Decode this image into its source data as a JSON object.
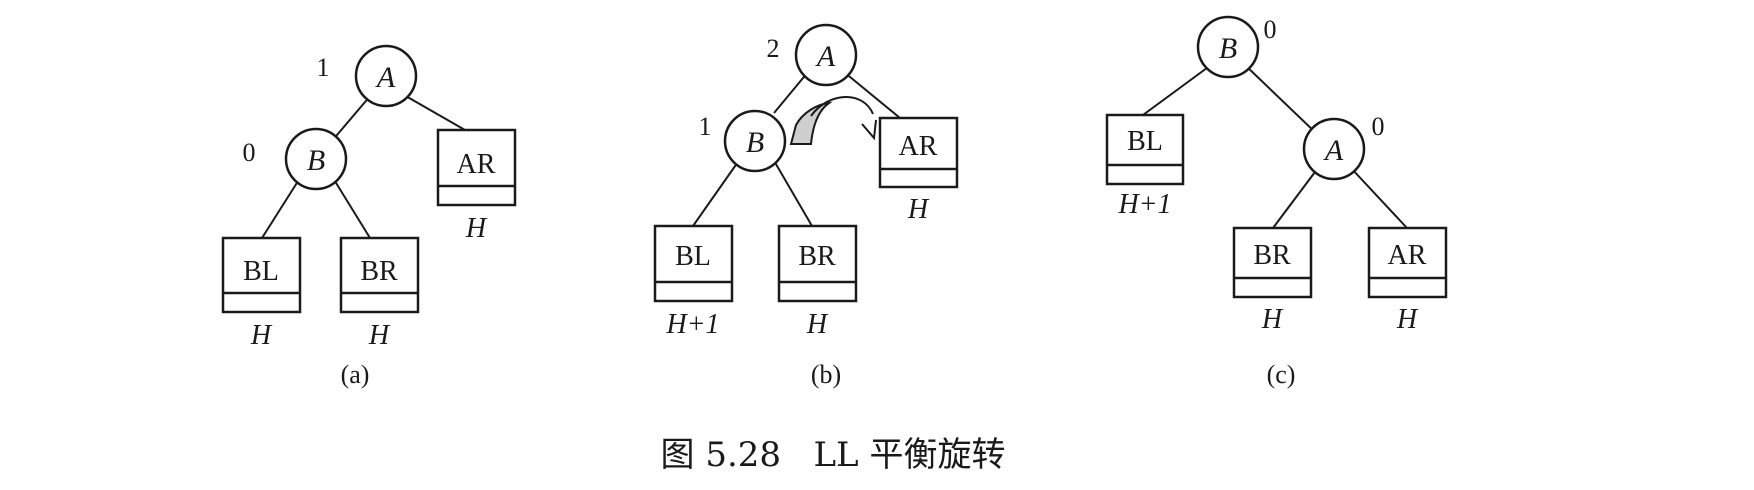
{
  "figure_caption": "图 5.28   LL 平衡旋转",
  "panels": [
    {
      "caption": "(a)",
      "nodes": [
        {
          "label": "A",
          "bf": "1"
        },
        {
          "label": "B",
          "bf": "0"
        }
      ],
      "subtrees": [
        {
          "label": "BL",
          "height": "H"
        },
        {
          "label": "BR",
          "height": "H"
        },
        {
          "label": "AR",
          "height": "H"
        }
      ]
    },
    {
      "caption": "(b)",
      "nodes": [
        {
          "label": "A",
          "bf": "2"
        },
        {
          "label": "B",
          "bf": "1"
        }
      ],
      "subtrees": [
        {
          "label": "BL",
          "height": "H+1"
        },
        {
          "label": "BR",
          "height": "H"
        },
        {
          "label": "AR",
          "height": "H"
        }
      ]
    },
    {
      "caption": "(c)",
      "nodes": [
        {
          "label": "B",
          "bf": "0"
        },
        {
          "label": "A",
          "bf": "0"
        }
      ],
      "subtrees": [
        {
          "label": "BL",
          "height": "H+1"
        },
        {
          "label": "BR",
          "height": "H"
        },
        {
          "label": "AR",
          "height": "H"
        }
      ]
    }
  ]
}
